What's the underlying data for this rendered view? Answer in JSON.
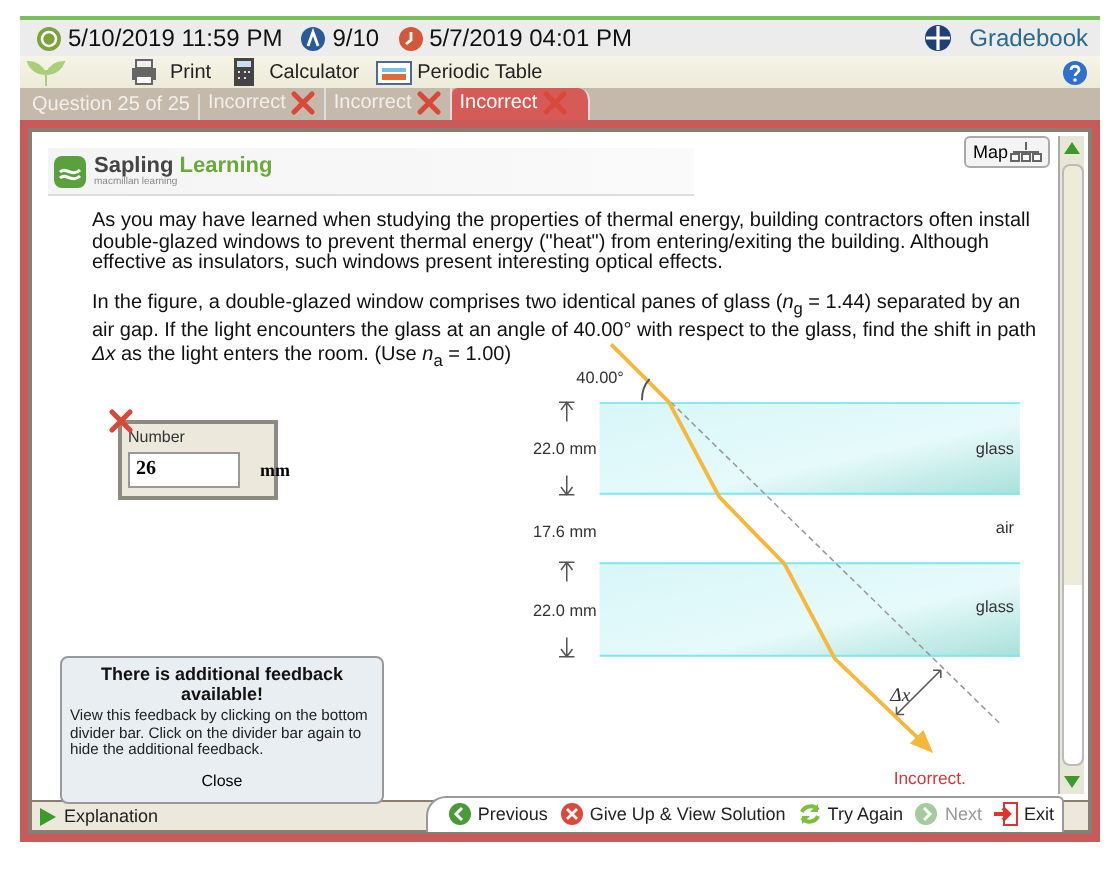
{
  "header": {
    "due_date": "5/10/2019 11:59 PM",
    "score": "9/10",
    "last_date": "5/7/2019 04:01 PM",
    "gradebook": "Gradebook"
  },
  "toolbar": [
    {
      "kind": "print",
      "label": "Print"
    },
    {
      "kind": "calculator",
      "label": "Calculator"
    },
    {
      "kind": "periodic",
      "label": "Periodic Table"
    }
  ],
  "question_label": "Question 25 of 25",
  "attempt_tabs": [
    {
      "label": "Incorrect",
      "selected": false
    },
    {
      "label": "Incorrect",
      "selected": false
    },
    {
      "label": "Incorrect",
      "selected": true
    }
  ],
  "logo": {
    "name": "Sapling",
    "name_accent": "Learning",
    "tagline": "macmillan learning"
  },
  "map_button": "Map",
  "paragraphs": [
    "As you may have learned when studying the properties of thermal energy, building contractors often install double-glazed windows to prevent thermal energy (\"heat\") from entering/exiting the building. Although effective as insulators, such windows present interesting optical effects.",
    "In the figure, a double-glazed window comprises two identical panes of glass (*n*$_{g}$ = 1.44) separated by an air gap. If the light encounters the glass at an angle of 40.00° with respect to the glass, find the shift in path *Δx* as the light enters the room. (Use *n*$_{a}$ = 1.00)"
  ],
  "answer": {
    "label": "Number",
    "value": "26",
    "unit": "mm",
    "correct": false
  },
  "diagram": {
    "angle": "40.00°",
    "pane_thickness_top": "22.0 mm",
    "gap": "17.6 mm",
    "pane_thickness_bottom": "22.0 mm",
    "layers": [
      "glass",
      "air",
      "glass"
    ],
    "shift": "Δx"
  },
  "result": "Incorrect.",
  "popup": {
    "title": "There is additional feedback available!",
    "body": "View this feedback by clicking on the bottom divider bar. Click on the divider bar again to hide the additional feedback.",
    "close": "Close"
  },
  "explanation": "Explanation",
  "nav": [
    {
      "kind": "previous",
      "label": "Previous",
      "disabled": false
    },
    {
      "kind": "giveup",
      "label": "Give Up & View Solution",
      "disabled": false
    },
    {
      "kind": "retry",
      "label": "Try Again",
      "disabled": false
    },
    {
      "kind": "next",
      "label": "Next",
      "disabled": true
    },
    {
      "kind": "exit",
      "label": "Exit",
      "disabled": false
    }
  ]
}
